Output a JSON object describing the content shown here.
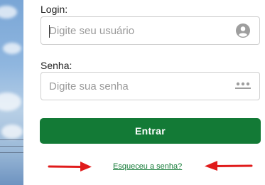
{
  "form": {
    "login_label": "Login:",
    "login_placeholder": "Digite seu usuário",
    "login_value": "",
    "senha_label": "Senha:",
    "senha_placeholder": "Digite sua senha",
    "senha_value": "",
    "submit_label": "Entrar",
    "forgot_link": "Esqueceu a senha?"
  },
  "icons": {
    "login_field_icon": "user-avatar-icon",
    "senha_field_icon": "password-dots-icon",
    "annotation_left": "red-arrow-right-icon",
    "annotation_right": "red-arrow-left-icon"
  },
  "colors": {
    "primary": "#137a36",
    "annotation": "#e01b1b",
    "placeholder": "#9a9a9a",
    "icon": "#9e9e9e"
  }
}
